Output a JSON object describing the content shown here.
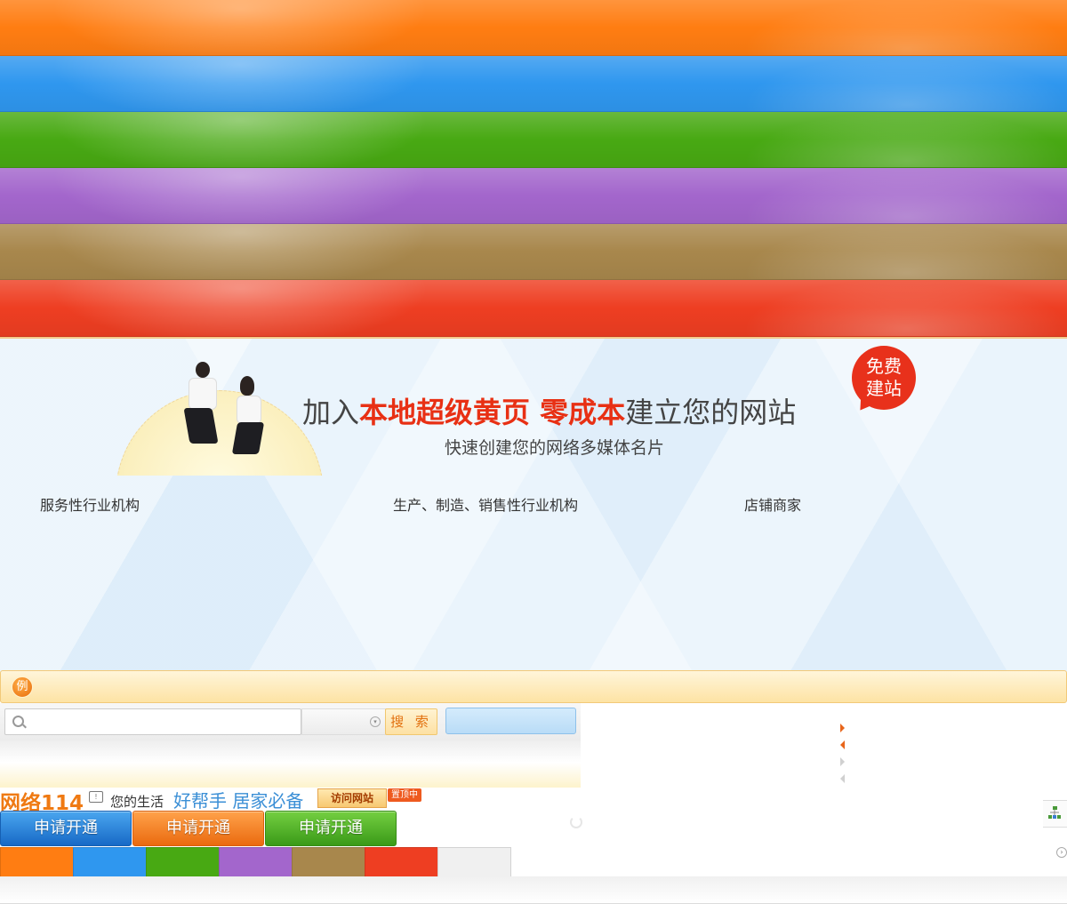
{
  "colors": {
    "banners": [
      "#ff7d12",
      "#2f97ef",
      "#48a913",
      "#a366cc",
      "#a8874c",
      "#ee3e22"
    ],
    "accent_red": "#e83014",
    "brand_orange": "#ef7a13",
    "swatches": [
      "#ff7d12",
      "#2f97ef",
      "#48a913",
      "#a366cc",
      "#a8874c",
      "#ee3e22",
      "#f0f0f0"
    ]
  },
  "hero": {
    "title_prefix": "加入",
    "title_highlight1": "本地超级黄页",
    "title_highlight2": "零成本",
    "title_suffix": "建立您的网站",
    "subtitle": "快速创建您的网络多媒体名片",
    "bubble_line1": "免费",
    "bubble_line2": "建站",
    "categories": [
      "服务性行业机构",
      "生产、制造、销售性行业机构",
      "店铺商家"
    ]
  },
  "notice": {
    "icon_text": "例"
  },
  "search": {
    "button_label": "搜 索"
  },
  "brand_row": {
    "brand": "网络114",
    "speech_icon_text": "!",
    "slogan_small": "您的生活",
    "slogan_big": "好帮手 居家必备",
    "visit_label": "访问网站",
    "pin_label": "置顶中"
  },
  "apply_buttons": [
    "申请开通",
    "申请开通",
    "申请开通"
  ],
  "icons": {
    "search": "search-icon",
    "select": "chevron-down-icon",
    "arrows": [
      "arrow-right-icon",
      "arrow-left-icon",
      "arrow-right-icon",
      "arrow-left-icon"
    ]
  }
}
